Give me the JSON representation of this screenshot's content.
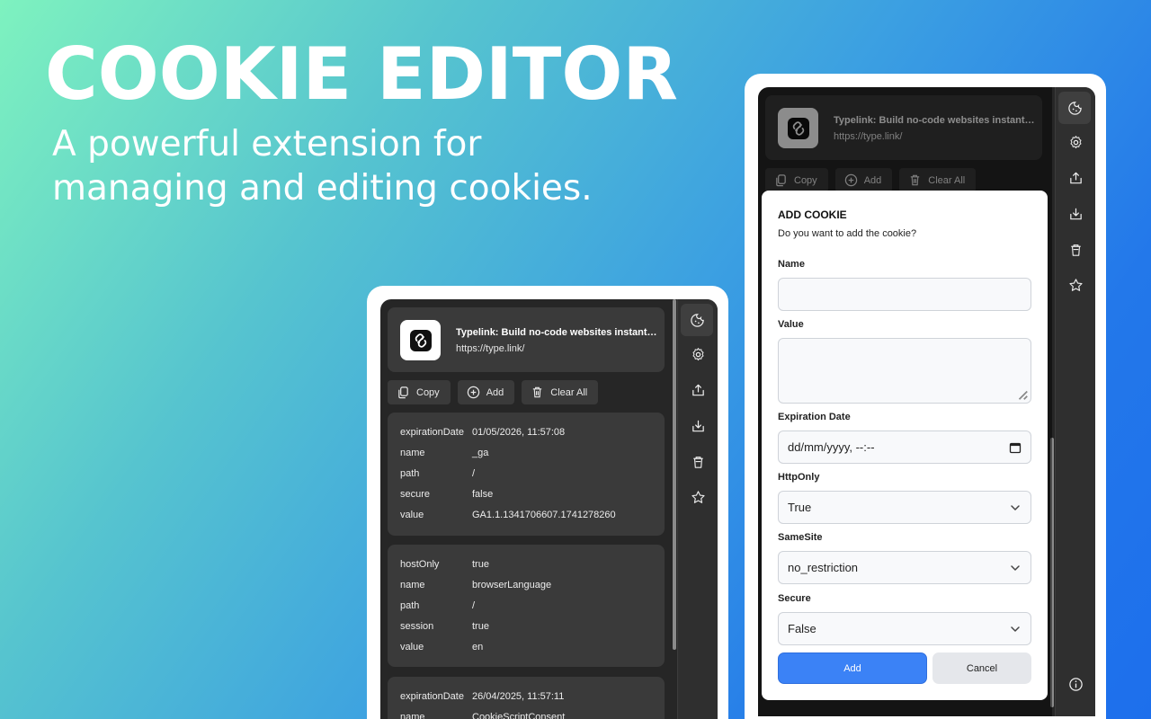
{
  "hero": {
    "title": "COOKIE EDITOR",
    "subtitle_line1": "A powerful extension for",
    "subtitle_line2": "managing and editing cookies."
  },
  "site": {
    "title": "Typelink: Build no-code websites instantly …",
    "url": "https://type.link/"
  },
  "toolbar": {
    "copy": "Copy",
    "add": "Add",
    "clear_all": "Clear All"
  },
  "cookies": [
    {
      "rows": [
        {
          "key": "expirationDate",
          "value": "01/05/2026, 11:57:08"
        },
        {
          "key": "name",
          "value": "_ga"
        },
        {
          "key": "path",
          "value": "/"
        },
        {
          "key": "secure",
          "value": "false"
        },
        {
          "key": "value",
          "value": "GA1.1.1341706607.1741278260"
        }
      ]
    },
    {
      "rows": [
        {
          "key": "hostOnly",
          "value": "true"
        },
        {
          "key": "name",
          "value": "browserLanguage"
        },
        {
          "key": "path",
          "value": "/"
        },
        {
          "key": "session",
          "value": "true"
        },
        {
          "key": "value",
          "value": "en"
        }
      ]
    },
    {
      "rows": [
        {
          "key": "expirationDate",
          "value": "26/04/2025, 11:57:11"
        },
        {
          "key": "name",
          "value": "CookieScriptConsent"
        }
      ]
    }
  ],
  "sidebar_icons": [
    "cookie-icon",
    "gear-icon",
    "export-icon",
    "import-icon",
    "delete-icon",
    "star-icon",
    "info-icon"
  ],
  "dialog": {
    "title": "ADD COOKIE",
    "description": "Do you want to add the cookie?",
    "name_label": "Name",
    "name_value": "",
    "value_label": "Value",
    "value_value": "",
    "expiration_label": "Expiration Date",
    "expiration_placeholder": "dd/mm/yyyy, --:--",
    "httponly_label": "HttpOnly",
    "httponly_value": "True",
    "samesite_label": "SameSite",
    "samesite_value": "no_restriction",
    "secure_label": "Secure",
    "secure_value": "False",
    "add_button": "Add",
    "cancel_button": "Cancel"
  },
  "colors": {
    "popup_bg": "#262626",
    "card_bg": "#3a3a3a",
    "primary": "#3b82f6"
  }
}
